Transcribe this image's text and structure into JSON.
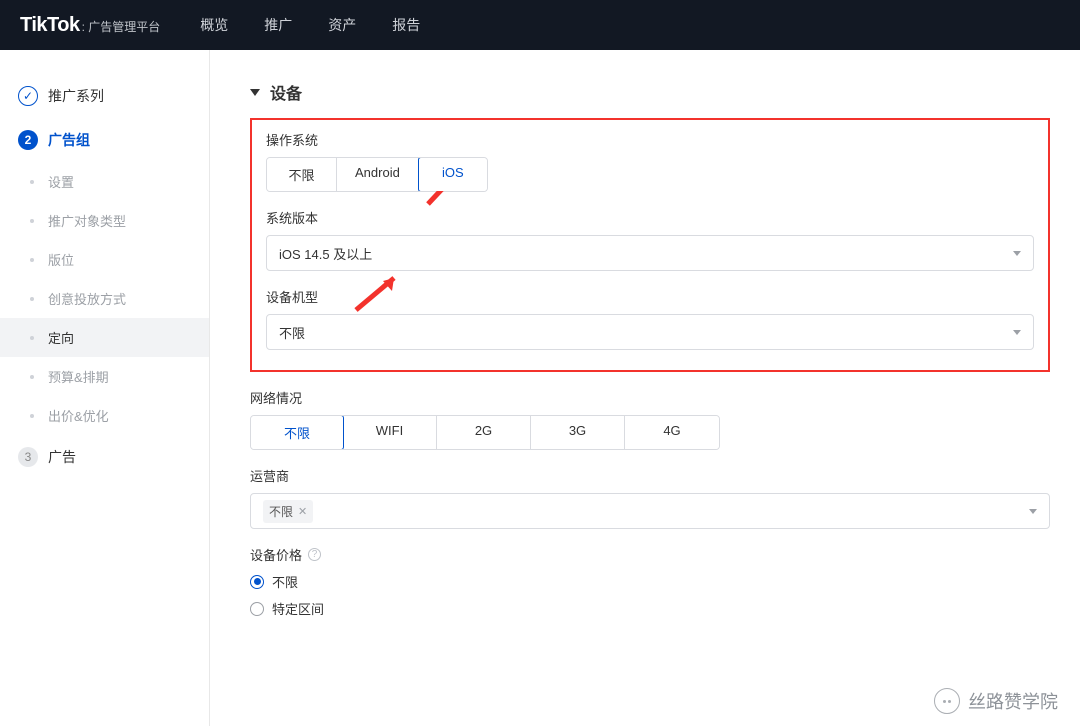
{
  "brand": {
    "logo": "TikTok",
    "suffix": ": 广告管理平台"
  },
  "topnav": {
    "items": [
      "概览",
      "推广",
      "资产",
      "报告"
    ]
  },
  "sidebar": {
    "steps": [
      {
        "label": "推广系列"
      },
      {
        "label": "广告组",
        "num": "2"
      },
      {
        "label": "广告",
        "num": "3"
      }
    ],
    "subs": [
      "设置",
      "推广对象类型",
      "版位",
      "创意投放方式",
      "定向",
      "预算&排期",
      "出价&优化"
    ]
  },
  "section": {
    "title": "设备"
  },
  "os": {
    "label": "操作系统",
    "options": [
      "不限",
      "Android",
      "iOS"
    ]
  },
  "version": {
    "label": "系统版本",
    "selected": "iOS 14.5 及以上"
  },
  "model": {
    "label": "设备机型",
    "selected": "不限"
  },
  "network": {
    "label": "网络情况",
    "options": [
      "不限",
      "WIFI",
      "2G",
      "3G",
      "4G"
    ]
  },
  "carrier": {
    "label": "运营商",
    "tag": "不限"
  },
  "price": {
    "label": "设备价格",
    "options": [
      "不限",
      "特定区间"
    ]
  },
  "watermark": {
    "text": "丝路赞学院"
  }
}
